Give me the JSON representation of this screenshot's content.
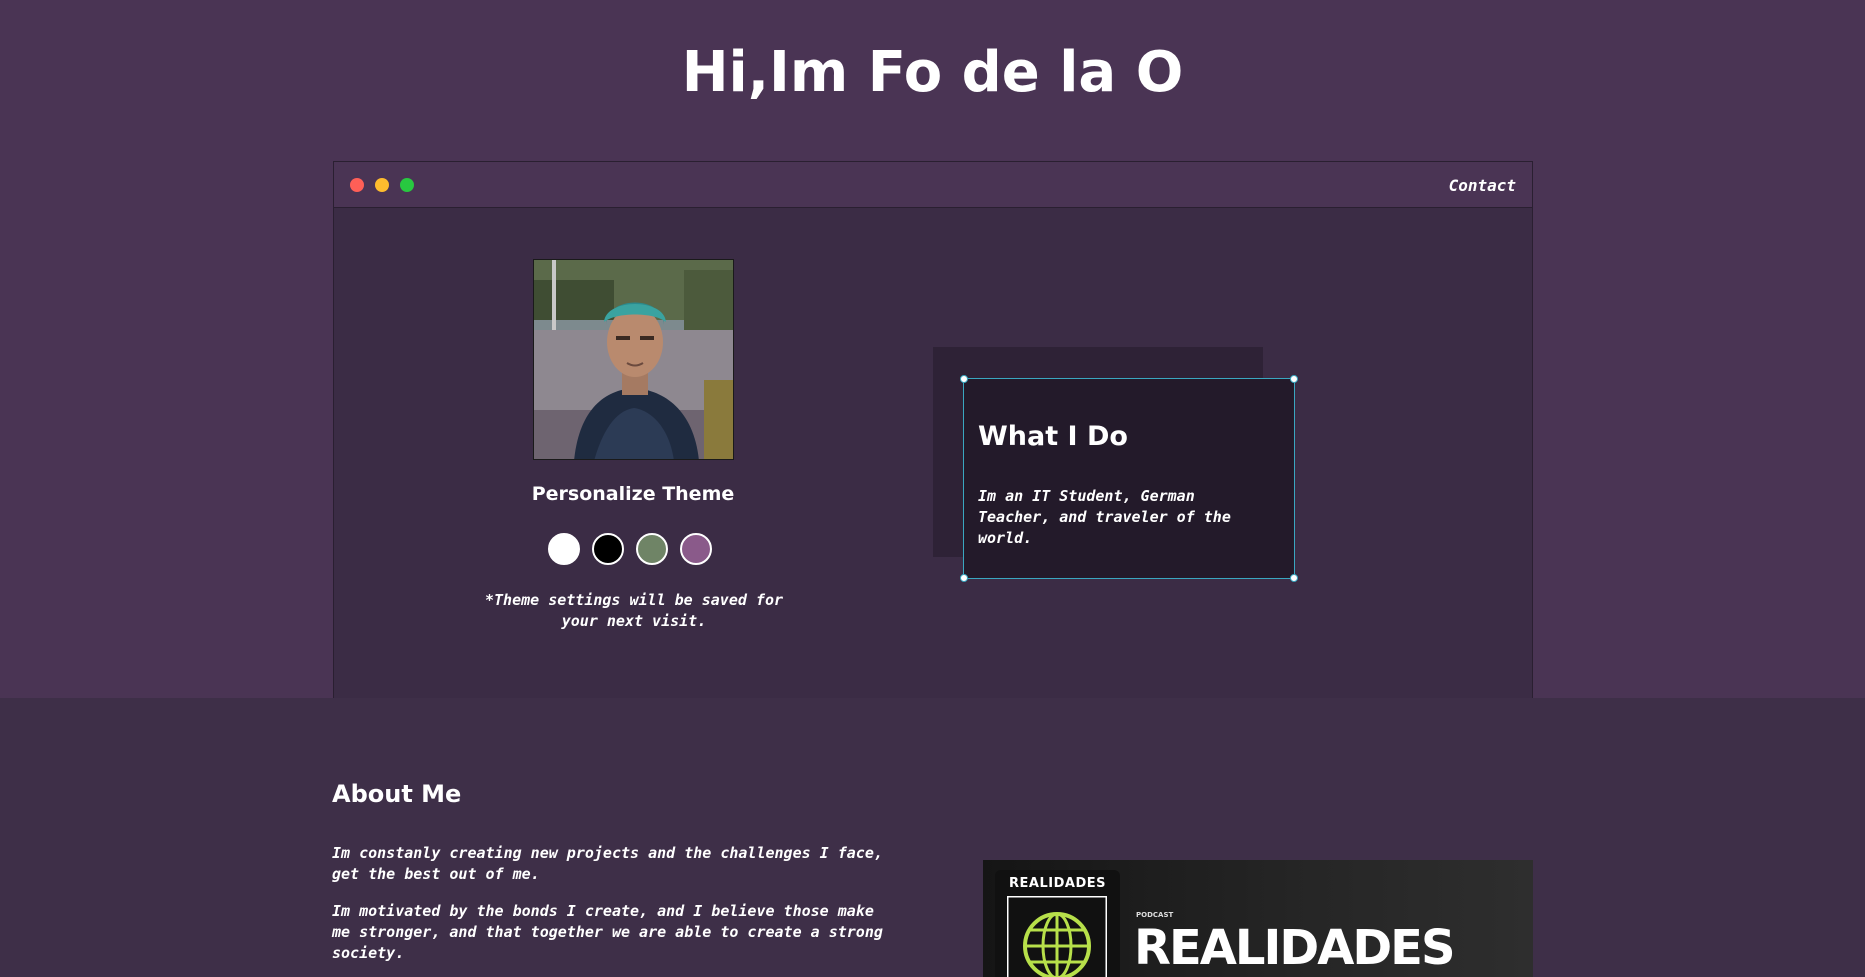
{
  "header": {
    "title": "Hi,Im Fo de la O"
  },
  "window": {
    "contact_label": "Contact"
  },
  "profile": {
    "theme_title": "Personalize Theme",
    "theme_colors": [
      "#ffffff",
      "#000000",
      "#6f8466",
      "#8a5a8a"
    ],
    "theme_note": "*Theme settings will be saved for your next visit."
  },
  "what_i_do": {
    "title": "What I Do",
    "text": "Im an IT Student, German Teacher, and traveler of the world."
  },
  "about": {
    "title": "About Me",
    "paragraphs": [
      "Im constanly creating new projects and the challenges I face, get the best out of me.",
      "Im motivated by the bonds I create, and I believe those make me stronger, and that together we are able to create a strong society."
    ]
  },
  "podcast": {
    "logo_text": "REALIDADES",
    "label": "PODCAST",
    "name": "REALIDADES"
  }
}
